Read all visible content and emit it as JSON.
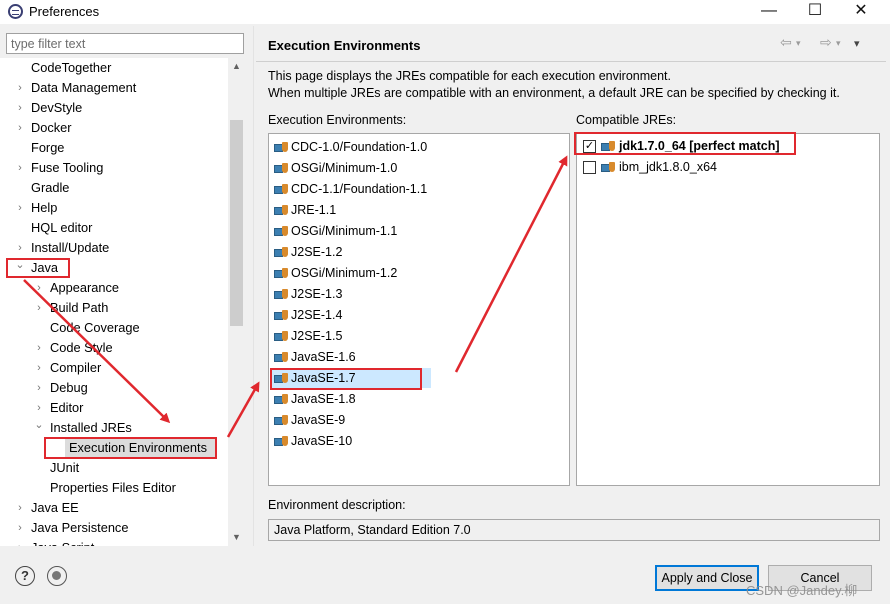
{
  "window": {
    "title": "Preferences",
    "minimize_glyph": "—",
    "maximize_glyph": "☐",
    "close_glyph": "✕"
  },
  "filter": {
    "placeholder": "type filter text"
  },
  "tree": [
    {
      "label": "CodeTogether",
      "expander": ""
    },
    {
      "label": "Data Management",
      "expander": "›"
    },
    {
      "label": "DevStyle",
      "expander": "›"
    },
    {
      "label": "Docker",
      "expander": "›"
    },
    {
      "label": "Forge",
      "expander": ""
    },
    {
      "label": "Fuse Tooling",
      "expander": "›"
    },
    {
      "label": "Gradle",
      "expander": ""
    },
    {
      "label": "Help",
      "expander": "›"
    },
    {
      "label": "HQL editor",
      "expander": ""
    },
    {
      "label": "Install/Update",
      "expander": "›"
    },
    {
      "label": "Java",
      "expander": "⌄"
    },
    {
      "label": "Appearance",
      "expander": "›"
    },
    {
      "label": "Build Path",
      "expander": "›"
    },
    {
      "label": "Code Coverage",
      "expander": ""
    },
    {
      "label": "Code Style",
      "expander": "›"
    },
    {
      "label": "Compiler",
      "expander": "›"
    },
    {
      "label": "Debug",
      "expander": "›"
    },
    {
      "label": "Editor",
      "expander": "›"
    },
    {
      "label": "Installed JREs",
      "expander": "⌄"
    },
    {
      "label": "Execution Environments",
      "expander": ""
    },
    {
      "label": "JUnit",
      "expander": ""
    },
    {
      "label": "Properties Files Editor",
      "expander": ""
    },
    {
      "label": "Java EE",
      "expander": "›"
    },
    {
      "label": "Java Persistence",
      "expander": "›"
    },
    {
      "label": "Java Script",
      "expander": "›"
    }
  ],
  "page": {
    "title": "Execution Environments",
    "description_line1": "This page displays the JREs compatible for each execution environment.",
    "description_line2": "When multiple JREs are compatible with an environment, a default JRE can be specified by checking it.",
    "environments_label": "Execution Environments:",
    "compatible_label": "Compatible JREs:",
    "environments": [
      "CDC-1.0/Foundation-1.0",
      "OSGi/Minimum-1.0",
      "CDC-1.1/Foundation-1.1",
      "JRE-1.1",
      "OSGi/Minimum-1.1",
      "J2SE-1.2",
      "OSGi/Minimum-1.2",
      "J2SE-1.3",
      "J2SE-1.4",
      "J2SE-1.5",
      "JavaSE-1.6",
      "JavaSE-1.7",
      "JavaSE-1.8",
      "JavaSE-9",
      "JavaSE-10"
    ],
    "selected_environment": "JavaSE-1.7",
    "jres": [
      {
        "label": "jdk1.7.0_64 [perfect match]",
        "checked": true
      },
      {
        "label": "ibm_jdk1.8.0_x64",
        "checked": false
      }
    ],
    "env_description_label": "Environment description:",
    "env_description": "Java Platform, Standard Edition 7.0"
  },
  "buttons": {
    "apply_close": "Apply and Close",
    "cancel": "Cancel"
  },
  "nav_glyphs": {
    "back": "⇦",
    "forward": "⇨",
    "menu": "▾"
  },
  "watermark": "CSDN @Jandey.柳",
  "colors": {
    "annotation": "#e0282e",
    "selection": "#cce8ff",
    "default_button_border": "#0078d7"
  }
}
